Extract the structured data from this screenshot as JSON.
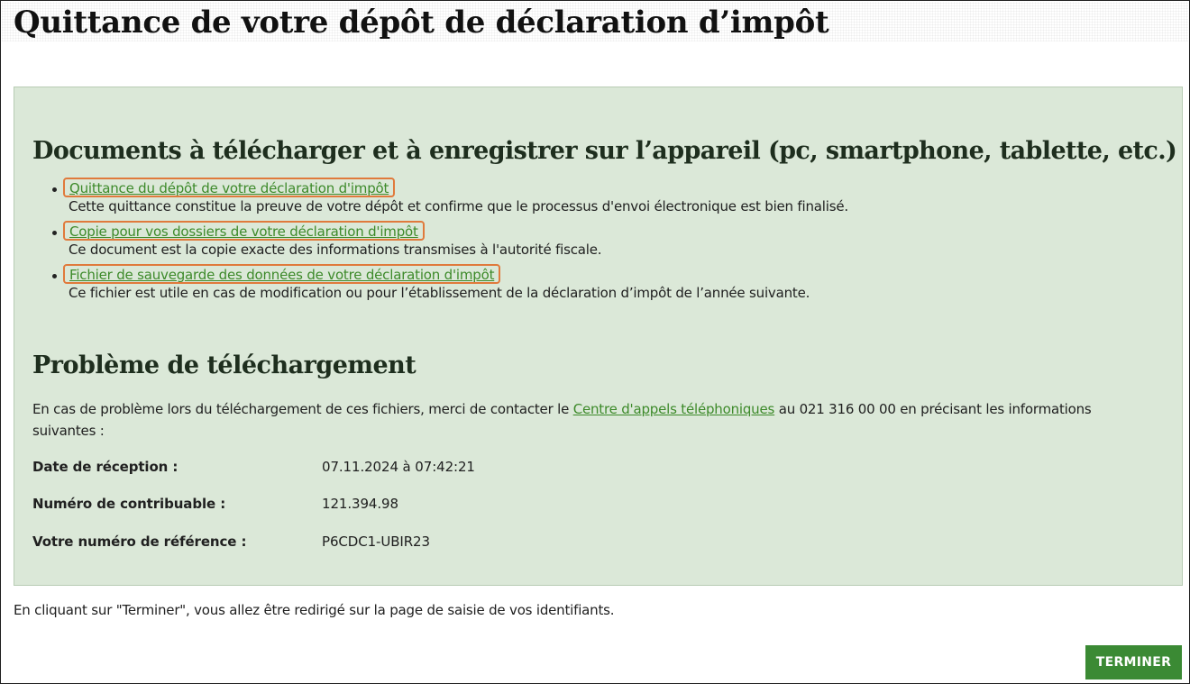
{
  "page": {
    "title": "Quittance de votre dépôt de déclaration d’impôt"
  },
  "documents": {
    "heading": "Documents à télécharger et à enregistrer sur l’appareil (pc, smartphone, tablette, etc.)",
    "items": [
      {
        "link": "Quittance du dépôt de votre déclaration d'impôt",
        "description": "Cette quittance constitue la preuve de votre dépôt et confirme que le processus d'envoi électronique est bien finalisé."
      },
      {
        "link": "Copie pour vos dossiers de votre déclaration d'impôt",
        "description": "Ce document est la copie exacte des informations transmises à l'autorité fiscale."
      },
      {
        "link": "Fichier de sauvegarde des données de votre déclaration d'impôt",
        "description": "Ce fichier est utile en cas de modification ou pour l’établissement de la déclaration d’impôt de l’année suivante."
      }
    ]
  },
  "problem": {
    "heading": "Problème de téléchargement",
    "intro_before": "En cas de problème lors du téléchargement de ces fichiers, merci de contacter le ",
    "call_center_link": "Centre d'appels téléphoniques",
    "intro_after": " au 021 316 00 00 en précisant les informations suivantes :",
    "fields": [
      {
        "label": "Date de réception :",
        "value": "07.11.2024 à 07:42:21"
      },
      {
        "label": "Numéro de contribuable :",
        "value": "121.394.98"
      },
      {
        "label": "Votre numéro de référence :",
        "value": "P6CDC1-UBIR23"
      }
    ]
  },
  "footer": {
    "note": "En cliquant sur \"Terminer\", vous allez être redirigé sur la page de saisie de vos identifiants.",
    "finish_label": "TERMINER"
  },
  "colors": {
    "panel_background": "#dbe8d8",
    "link": "#3d8a2a",
    "highlight_box": "#e07a3c",
    "button": "#3b8a34"
  }
}
